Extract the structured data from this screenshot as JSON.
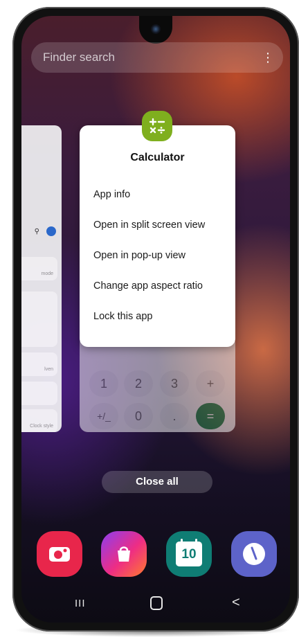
{
  "search": {
    "placeholder": "Finder search"
  },
  "popup": {
    "app_name": "Calculator",
    "items": [
      "App info",
      "Open in split screen view",
      "Open in pop-up view",
      "Change app aspect ratio",
      "Lock this app"
    ]
  },
  "left_card": {
    "rows": [
      "mode",
      "",
      "lven",
      "Clock style"
    ]
  },
  "keypad": {
    "keys": [
      "1",
      "2",
      "3",
      "+",
      "+/_",
      "0",
      ".",
      "="
    ]
  },
  "close_all_label": "Close all",
  "dock": {
    "calendar_day": "10",
    "icons": [
      "camera-icon",
      "galaxy-store-icon",
      "calendar-icon",
      "clock-icon"
    ]
  },
  "nav": {
    "recent": "III",
    "home": "O",
    "back": "<"
  },
  "colors": {
    "app_icon_green": "#7faf1e",
    "equals_green": "#1a7d46",
    "camera_red": "#e8264b",
    "calendar_teal": "#0f7d74",
    "clock_blue": "#5d63c9"
  }
}
